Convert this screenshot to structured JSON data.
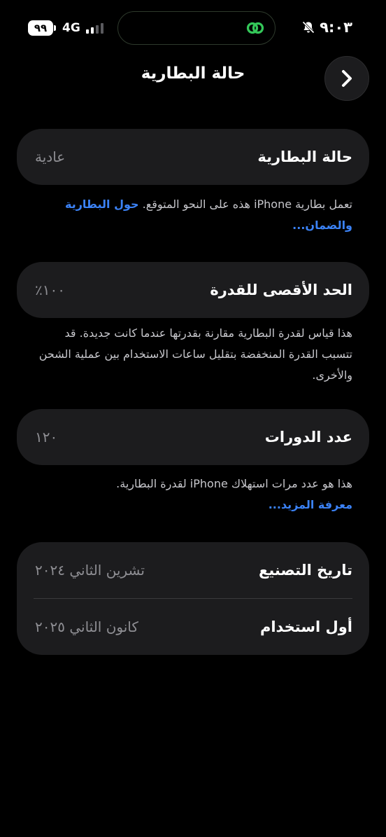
{
  "status_bar": {
    "battery_level": "٩٩",
    "network": "4G",
    "time": "٩:٠٣",
    "island_icon": "link-rings-icon",
    "island_color": "#34c759",
    "silent_icon": "bell-slash-icon"
  },
  "nav": {
    "title": "حالة البطارية",
    "back_icon": "chevron-right-icon"
  },
  "battery_condition": {
    "label": "حالة البطارية",
    "value": "عادية",
    "footnote": "تعمل بطارية iPhone هذه على النحو المتوقع.",
    "link": "حول البطارية والضمان..."
  },
  "max_capacity": {
    "label": "الحد الأقصى للقدرة",
    "value": "١٠٠٪",
    "footnote": "هذا قياس لقدرة البطارية مقارنة بقدرتها عندما كانت جديدة. قد تتسبب القدرة المنخفضة بتقليل ساعات الاستخدام بين عملية الشحن والأخرى."
  },
  "cycle_count": {
    "label": "عدد الدورات",
    "value": "١٢٠",
    "footnote": "هذا هو عدد مرات استهلاك iPhone لقدرة البطارية.",
    "link": "معرفة المزيد..."
  },
  "dates": {
    "manufacture_label": "تاريخ التصنيع",
    "manufacture_value": "تشرين الثاني ٢٠٢٤",
    "first_use_label": "أول استخدام",
    "first_use_value": "كانون الثاني ٢٠٢٥"
  },
  "colors": {
    "background": "#000000",
    "card": "#1c1c1e",
    "link": "#3b82f6",
    "secondary_text": "#8e8e93"
  }
}
